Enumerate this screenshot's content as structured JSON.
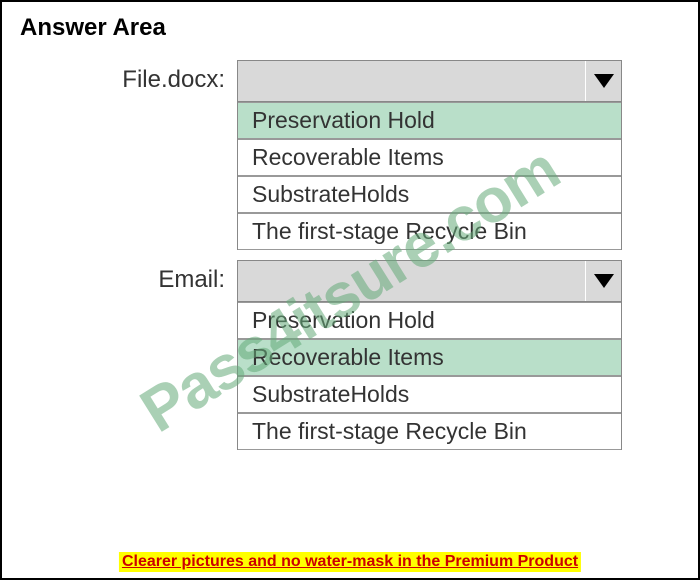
{
  "title": "Answer Area",
  "rows": [
    {
      "label": "File.docx:",
      "options": [
        {
          "text": "Preservation Hold",
          "selected": true
        },
        {
          "text": "Recoverable Items",
          "selected": false
        },
        {
          "text": "SubstrateHolds",
          "selected": false
        },
        {
          "text": "The first-stage Recycle Bin",
          "selected": false
        }
      ]
    },
    {
      "label": "Email:",
      "options": [
        {
          "text": "Preservation Hold",
          "selected": false
        },
        {
          "text": "Recoverable Items",
          "selected": true
        },
        {
          "text": "SubstrateHolds",
          "selected": false
        },
        {
          "text": "The first-stage Recycle Bin",
          "selected": false
        }
      ]
    }
  ],
  "watermark": "Pass4itsure.com",
  "footer": "Clearer pictures and no water-mask in the Premium Product"
}
